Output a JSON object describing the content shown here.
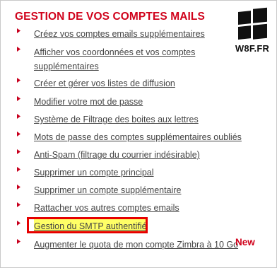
{
  "header": {
    "title": "GESTION DE VOS COMPTES MAILS"
  },
  "logo": {
    "icon": "windows-logo-icon",
    "text": "W8F.FR"
  },
  "colors": {
    "title": "#d0021b",
    "link": "#444444",
    "bullet": "#c8001e",
    "highlight_box": "#e60000",
    "highlight_fill": "#ffff66",
    "new_badge": "#d0021b"
  },
  "menu": {
    "items": [
      {
        "label": "Créez vos comptes emails supplémentaires"
      },
      {
        "label": "Afficher vos coordonnées et vos comptes supplémentaires"
      },
      {
        "label": "Créer et gérer vos listes de diffusion"
      },
      {
        "label": "Modifier votre mot de passe"
      },
      {
        "label": "Système de Filtrage des boites aux lettres"
      },
      {
        "label": "Mots de passe des comptes supplémentaires oubliés"
      },
      {
        "label": "Anti-Spam (filtrage du courrier indésirable)"
      },
      {
        "label": "Supprimer un compte principal"
      },
      {
        "label": "Supprimer un compte supplémentaire"
      },
      {
        "label": "Rattacher vos autres comptes emails"
      },
      {
        "label": "Gestion du SMTP authentifié",
        "highlighted": true
      },
      {
        "label": "Augmenter le quota de mon compte Zimbra à 10 Go",
        "badge": "New"
      }
    ]
  }
}
